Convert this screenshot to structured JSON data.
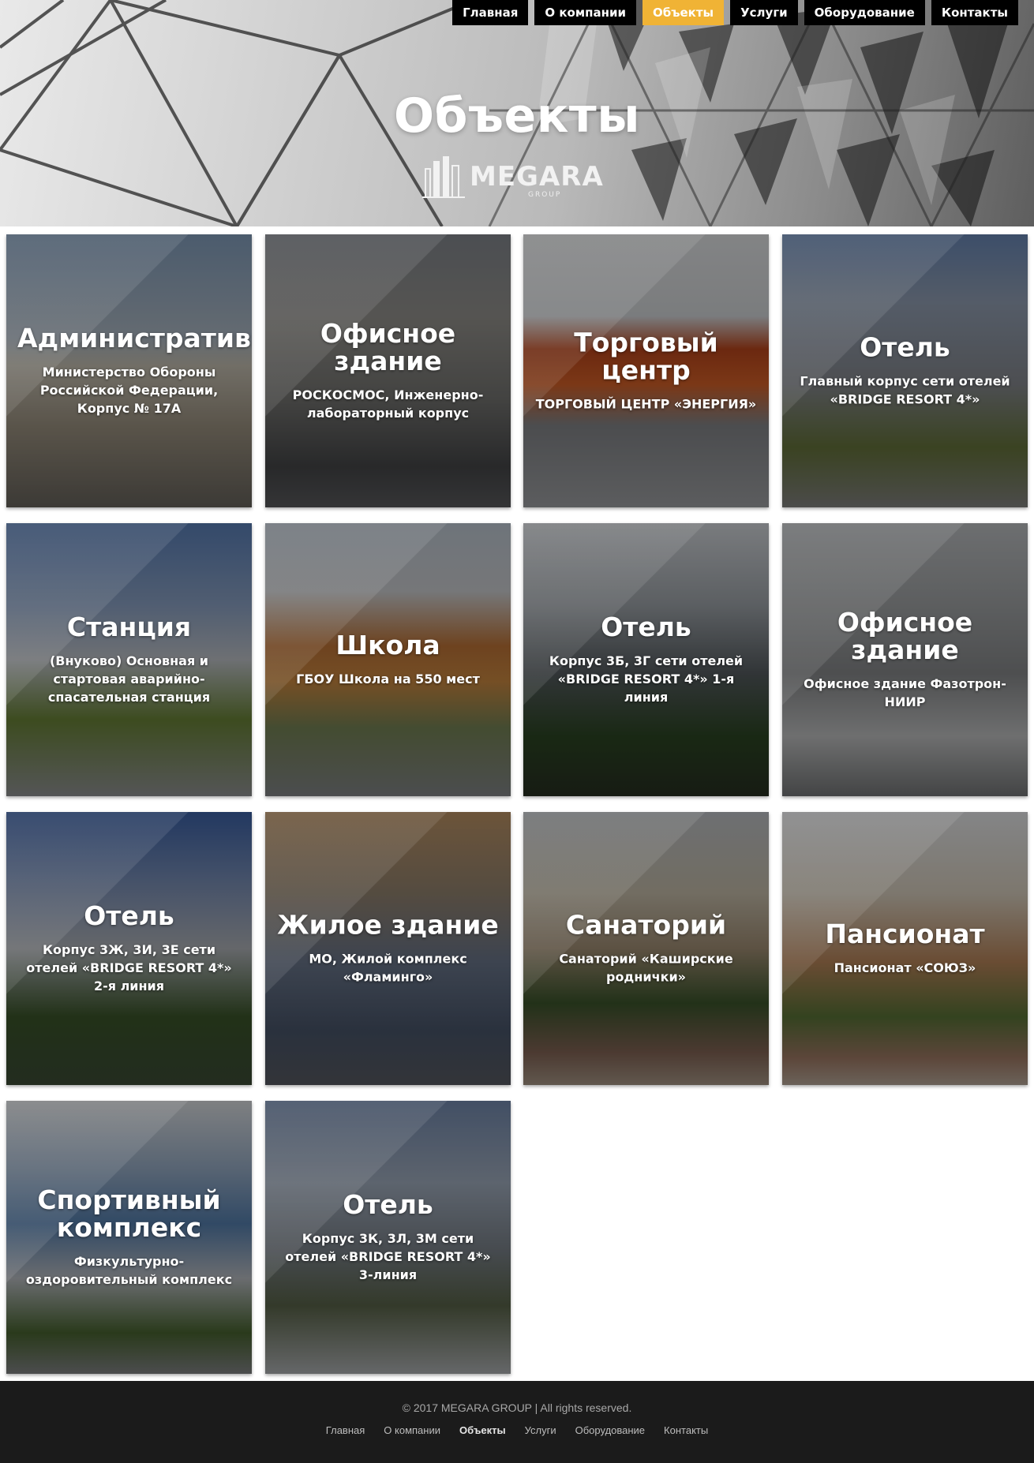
{
  "nav": {
    "items": [
      {
        "label": "Главная",
        "active": false
      },
      {
        "label": "О компании",
        "active": false
      },
      {
        "label": "Объекты",
        "active": true
      },
      {
        "label": "Услуги",
        "active": false
      },
      {
        "label": "Оборудование",
        "active": false
      },
      {
        "label": "Контакты",
        "active": false
      }
    ],
    "active_color": "#f0b335"
  },
  "hero": {
    "title": "Объекты",
    "logo_text": "MEGARA",
    "logo_sub": "GROUP"
  },
  "cards": [
    {
      "title": "Административное здание",
      "subtitle": "Министерство Обороны Российской Федерации, Корпус № 17А"
    },
    {
      "title": "Офисное здание",
      "subtitle": "РОСКОСМОС, Инженерно-лабораторный корпус"
    },
    {
      "title": "Торговый центр",
      "subtitle": "ТОРГОВЫЙ ЦЕНТР «ЭНЕРГИЯ»"
    },
    {
      "title": "Отель",
      "subtitle": "Главный корпус сети отелей «BRIDGE RESORT 4*»"
    },
    {
      "title": "Станция",
      "subtitle": "(Внуково) Основная и стартовая аварийно-спасательная станция"
    },
    {
      "title": "Школа",
      "subtitle": "ГБОУ Школа на 550 мест"
    },
    {
      "title": "Отель",
      "subtitle": "Корпус 3Б, 3Г сети отелей «BRIDGE RESORT 4*» 1-я линия"
    },
    {
      "title": "Офисное здание",
      "subtitle": "Офисное здание Фазотрон-НИИР"
    },
    {
      "title": "Отель",
      "subtitle": "Корпус 3Ж, 3И, 3Е сети отелей «BRIDGE RESORT 4*» 2-я линия"
    },
    {
      "title": "Жилое здание",
      "subtitle": "МО, Жилой комплекс «Фламинго»"
    },
    {
      "title": "Санаторий",
      "subtitle": "Санаторий «Каширские роднички»"
    },
    {
      "title": "Пансионат",
      "subtitle": "Пансионат «СОЮЗ»"
    },
    {
      "title": "Спортивный комплекс",
      "subtitle": "Физкультурно-оздоровительный комплекс"
    },
    {
      "title": "Отель",
      "subtitle": "Корпус 3К, 3Л, 3М сети отелей «BRIDGE RESORT 4*» 3-линия"
    }
  ],
  "footer": {
    "copyright": "© 2017 MEGARA GROUP | All rights reserved.",
    "links": [
      {
        "label": "Главная",
        "active": false
      },
      {
        "label": "О компании",
        "active": false
      },
      {
        "label": "Объекты",
        "active": true
      },
      {
        "label": "Услуги",
        "active": false
      },
      {
        "label": "Оборудование",
        "active": false
      },
      {
        "label": "Контакты",
        "active": false
      }
    ]
  }
}
